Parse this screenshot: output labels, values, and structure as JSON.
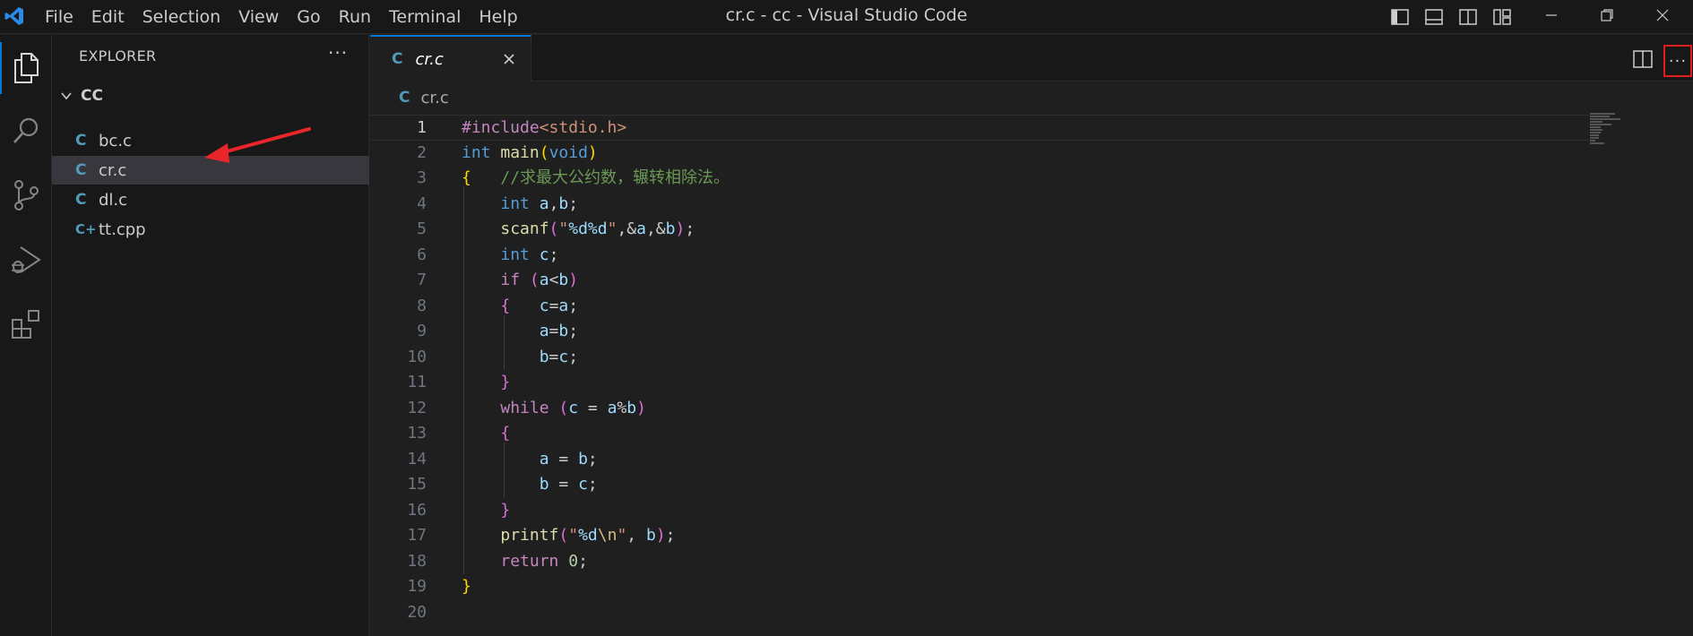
{
  "titlebar": {
    "menu": [
      "File",
      "Edit",
      "Selection",
      "View",
      "Go",
      "Run",
      "Terminal",
      "Help"
    ],
    "title": "cr.c - cc - Visual Studio Code"
  },
  "sidebar": {
    "header": "EXPLORER",
    "more": "···",
    "folder": "CC",
    "files": [
      {
        "icon": "C",
        "name": "bc.c"
      },
      {
        "icon": "C",
        "name": "cr.c",
        "selected": true
      },
      {
        "icon": "C",
        "name": "dl.c"
      },
      {
        "icon": "C+",
        "name": "tt.cpp"
      }
    ]
  },
  "editor": {
    "tab": {
      "icon": "C",
      "label": "cr.c"
    },
    "breadcrumb": {
      "icon": "C",
      "label": "cr.c"
    },
    "more": "···",
    "current_line": 1,
    "lines": [
      [
        [
          "pp",
          "#include"
        ],
        [
          "inc",
          "<stdio.h>"
        ]
      ],
      [
        [
          "kw",
          "int"
        ],
        [
          "plain",
          " "
        ],
        [
          "fn",
          "main"
        ],
        [
          "b1",
          "("
        ],
        [
          "kw",
          "void"
        ],
        [
          "b1",
          ")"
        ]
      ],
      [
        [
          "b1",
          "{"
        ],
        [
          "plain",
          "   "
        ],
        [
          "cm",
          "//求最大公约数，辗转相除法。"
        ]
      ],
      [
        [
          "plain",
          "    "
        ],
        [
          "kw",
          "int"
        ],
        [
          "plain",
          " "
        ],
        [
          "var",
          "a"
        ],
        [
          "plain",
          ","
        ],
        [
          "var",
          "b"
        ],
        [
          "plain",
          ";"
        ]
      ],
      [
        [
          "plain",
          "    "
        ],
        [
          "fn",
          "scanf"
        ],
        [
          "b2",
          "("
        ],
        [
          "str",
          "\""
        ],
        [
          "fmt",
          "%d%d"
        ],
        [
          "str",
          "\""
        ],
        [
          "plain",
          ","
        ],
        [
          "plain",
          "&"
        ],
        [
          "var",
          "a"
        ],
        [
          "plain",
          ",&"
        ],
        [
          "var",
          "b"
        ],
        [
          "b2",
          ")"
        ],
        [
          "plain",
          ";"
        ]
      ],
      [
        [
          "plain",
          "    "
        ],
        [
          "kw",
          "int"
        ],
        [
          "plain",
          " "
        ],
        [
          "var",
          "c"
        ],
        [
          "plain",
          ";"
        ]
      ],
      [
        [
          "plain",
          "    "
        ],
        [
          "ctl",
          "if"
        ],
        [
          "plain",
          " "
        ],
        [
          "b2",
          "("
        ],
        [
          "var",
          "a"
        ],
        [
          "plain",
          "<"
        ],
        [
          "var",
          "b"
        ],
        [
          "b2",
          ")"
        ]
      ],
      [
        [
          "plain",
          "    "
        ],
        [
          "b2",
          "{"
        ],
        [
          "plain",
          "   "
        ],
        [
          "var",
          "c"
        ],
        [
          "plain",
          "="
        ],
        [
          "var",
          "a"
        ],
        [
          "plain",
          ";"
        ]
      ],
      [
        [
          "plain",
          "        "
        ],
        [
          "var",
          "a"
        ],
        [
          "plain",
          "="
        ],
        [
          "var",
          "b"
        ],
        [
          "plain",
          ";"
        ]
      ],
      [
        [
          "plain",
          "        "
        ],
        [
          "var",
          "b"
        ],
        [
          "plain",
          "="
        ],
        [
          "var",
          "c"
        ],
        [
          "plain",
          ";"
        ]
      ],
      [
        [
          "plain",
          "    "
        ],
        [
          "b2",
          "}"
        ]
      ],
      [
        [
          "plain",
          "    "
        ],
        [
          "ctl",
          "while"
        ],
        [
          "plain",
          " "
        ],
        [
          "b2",
          "("
        ],
        [
          "var",
          "c"
        ],
        [
          "plain",
          " = "
        ],
        [
          "var",
          "a"
        ],
        [
          "plain",
          "%"
        ],
        [
          "var",
          "b"
        ],
        [
          "b2",
          ")"
        ]
      ],
      [
        [
          "plain",
          "    "
        ],
        [
          "b2",
          "{"
        ]
      ],
      [
        [
          "plain",
          "        "
        ],
        [
          "var",
          "a"
        ],
        [
          "plain",
          " = "
        ],
        [
          "var",
          "b"
        ],
        [
          "plain",
          ";"
        ]
      ],
      [
        [
          "plain",
          "        "
        ],
        [
          "var",
          "b"
        ],
        [
          "plain",
          " = "
        ],
        [
          "var",
          "c"
        ],
        [
          "plain",
          ";"
        ]
      ],
      [
        [
          "plain",
          "    "
        ],
        [
          "b2",
          "}"
        ]
      ],
      [
        [
          "plain",
          "    "
        ],
        [
          "fn",
          "printf"
        ],
        [
          "b2",
          "("
        ],
        [
          "str",
          "\""
        ],
        [
          "fmt",
          "%d"
        ],
        [
          "esc",
          "\\n"
        ],
        [
          "str",
          "\""
        ],
        [
          "plain",
          ", "
        ],
        [
          "var",
          "b"
        ],
        [
          "b2",
          ")"
        ],
        [
          "plain",
          ";"
        ]
      ],
      [
        [
          "plain",
          "    "
        ],
        [
          "ctl",
          "return"
        ],
        [
          "plain",
          " "
        ],
        [
          "num",
          "0"
        ],
        [
          "plain",
          ";"
        ]
      ],
      [
        [
          "b1",
          "}"
        ]
      ],
      []
    ]
  },
  "colors": {
    "accent": "#0078d4",
    "highlight_box": "#e11d1d",
    "arrow": "#e8262a",
    "c_icon": "#519aba"
  }
}
